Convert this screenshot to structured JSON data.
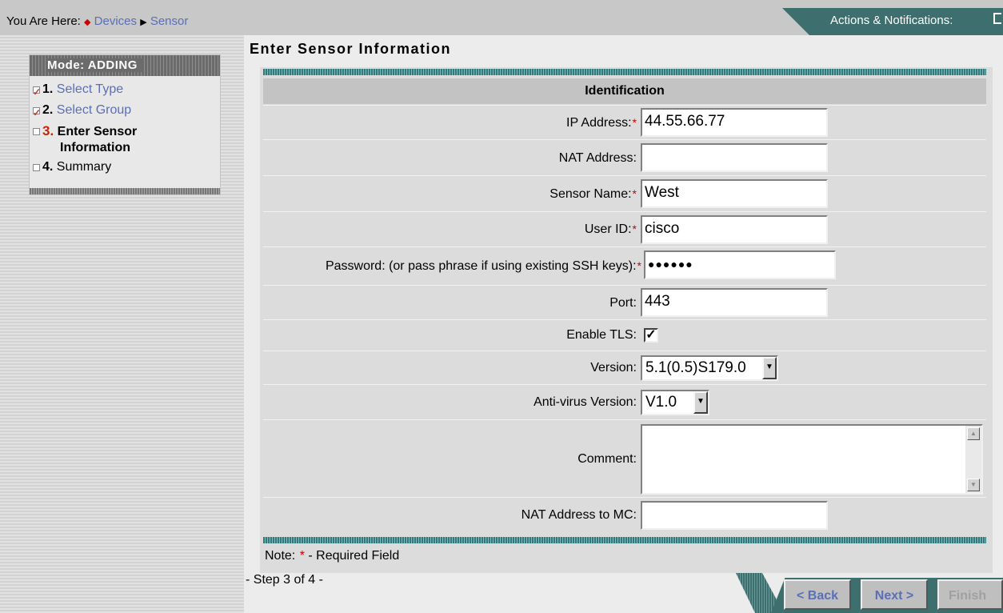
{
  "breadcrumb": {
    "prefix": "You Are Here:",
    "items": [
      "Devices",
      "Sensor"
    ]
  },
  "actions": {
    "label": "Actions & Notifications:"
  },
  "wizard": {
    "mode": "Mode: ADDING",
    "steps": [
      {
        "num": "1.",
        "label": "Select Type",
        "checked": true
      },
      {
        "num": "2.",
        "label": "Select Group",
        "checked": true
      },
      {
        "num": "3.",
        "label": "Enter Sensor",
        "label2": "Information",
        "checked": false,
        "current": true
      },
      {
        "num": "4.",
        "label": "Summary",
        "checked": false
      }
    ]
  },
  "page": {
    "title": "Enter Sensor Information",
    "section": "Identification"
  },
  "form": {
    "ip_label": "IP Address:",
    "ip_value": "44.55.66.77",
    "nat_label": "NAT Address:",
    "nat_value": "",
    "name_label": "Sensor Name:",
    "name_value": "West",
    "user_label": "User ID:",
    "user_value": "cisco",
    "password_label": "Password: (or pass phrase if using existing SSH keys):",
    "password_value": "●●●●●●",
    "port_label": "Port:",
    "port_value": "443",
    "tls_label": "Enable TLS:",
    "tls_checked": true,
    "version_label": "Version:",
    "version_value": "5.1(0.5)S179.0",
    "av_label": "Anti-virus Version:",
    "av_value": "V1.0",
    "comment_label": "Comment:",
    "comment_value": "",
    "natmc_label": "NAT Address to MC:",
    "natmc_value": "",
    "required_mark": "*"
  },
  "footer": {
    "note_prefix": "Note:",
    "note_suffix": "-  Required Field",
    "step_info": "- Step 3 of 4 -",
    "back_label": "< Back",
    "next_label": "Next >",
    "finish_label": "Finish"
  },
  "colors": {
    "accent_teal": "#3d6f6f",
    "link": "#5a6fb5",
    "required": "#cc0000"
  }
}
